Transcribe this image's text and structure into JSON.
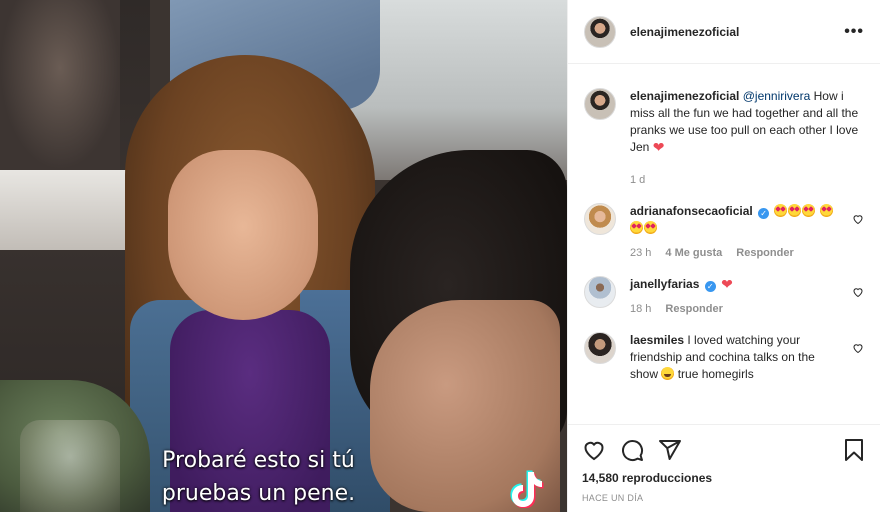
{
  "video": {
    "subtitle_line1": "Probaré esto si tú",
    "subtitle_line2": "pruebas un pene."
  },
  "header": {
    "username": "elenajimenezoficial",
    "more_icon": "more-horizontal-icon"
  },
  "caption": {
    "username": "elenajimenezoficial",
    "mention": "@jennirivera",
    "text": " How i miss all the fun we had together and all the pranks we use too pull on each other I love Jen ",
    "time": "1 d"
  },
  "comments": [
    {
      "username": "adrianafonsecaoficial",
      "verified": true,
      "time": "23 h",
      "likes": "4 Me gusta",
      "reply": "Responder"
    },
    {
      "username": "janellyfarias",
      "verified": true,
      "time": "18 h",
      "reply": "Responder"
    },
    {
      "username": "laesmiles",
      "verified": false,
      "text": " I loved watching your friendship and cochina talks on the show ",
      "text_end": " true homegirls"
    }
  ],
  "footer": {
    "views": "14,580 reproducciones",
    "time_ago": "HACE UN DÍA"
  },
  "colors": {
    "link": "#00376b",
    "verified": "#3897f0",
    "heart": "#ed4956",
    "muted": "#8e8e8e"
  }
}
